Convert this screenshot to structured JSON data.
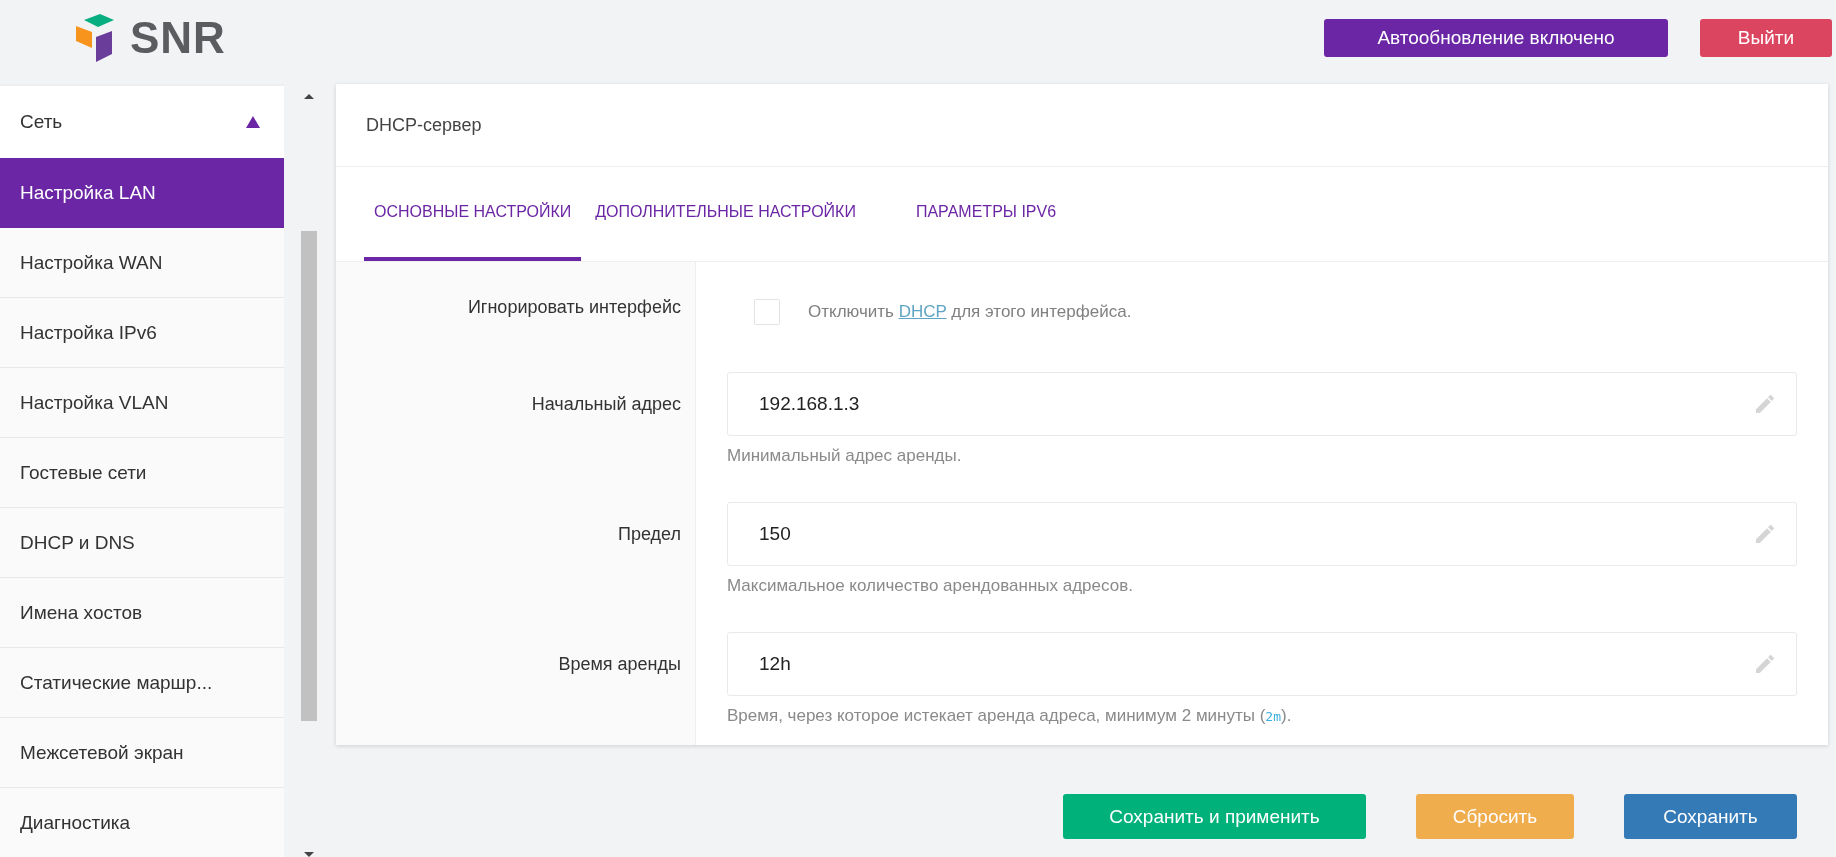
{
  "header": {
    "logo_text": "SNR",
    "buttons": [
      {
        "label": "Автообновление включено",
        "kind": "primary"
      },
      {
        "label": "Выйти",
        "kind": "danger"
      }
    ]
  },
  "sidebar": {
    "section": {
      "label": "Сеть",
      "expanded": true
    },
    "items": [
      {
        "label": "Настройка LAN",
        "selected": true
      },
      {
        "label": "Настройка WAN",
        "selected": false
      },
      {
        "label": "Настройка IPv6",
        "selected": false
      },
      {
        "label": "Настройка VLAN",
        "selected": false
      },
      {
        "label": "Гостевые сети",
        "selected": false
      },
      {
        "label": "DHCP и DNS",
        "selected": false
      },
      {
        "label": "Имена хостов",
        "selected": false
      },
      {
        "label": "Статические маршр...",
        "selected": false
      },
      {
        "label": "Межсетевой экран",
        "selected": false
      },
      {
        "label": "Диагностика",
        "selected": false
      }
    ]
  },
  "card": {
    "title": "DHCP-сервер",
    "tabs": [
      {
        "label": "ОСНОВНЫЕ НАСТРОЙКИ",
        "selected": true
      },
      {
        "label": "ДОПОЛНИТЕЛЬНЫЕ НАСТРОЙКИ",
        "selected": false
      },
      {
        "label": "ПАРАМЕТРЫ IPV6",
        "selected": false
      }
    ],
    "fields": [
      {
        "kind": "checkbox",
        "label": "Игнорировать интерфейс",
        "checked": false,
        "description_before": "Отключить ",
        "description_link": "DHCP",
        "description_after": " для этого интерфейса."
      },
      {
        "kind": "text",
        "label": "Начальный адрес",
        "value": "192.168.1.3",
        "hint": "Минимальный адрес аренды."
      },
      {
        "kind": "text",
        "label": "Предел",
        "value": "150",
        "hint": "Максимальное количество арендованных адресов."
      },
      {
        "kind": "text",
        "label": "Время аренды",
        "value": "12h",
        "hint": "Время, через которое истекает аренда адреса, минимум 2 минуты (",
        "hint_code": "2m",
        "hint_after": ")."
      }
    ]
  },
  "actions": [
    {
      "label": "Сохранить и применить",
      "kind": "apply"
    },
    {
      "label": "Сбросить",
      "kind": "reset"
    },
    {
      "label": "Сохранить",
      "kind": "save"
    }
  ]
}
